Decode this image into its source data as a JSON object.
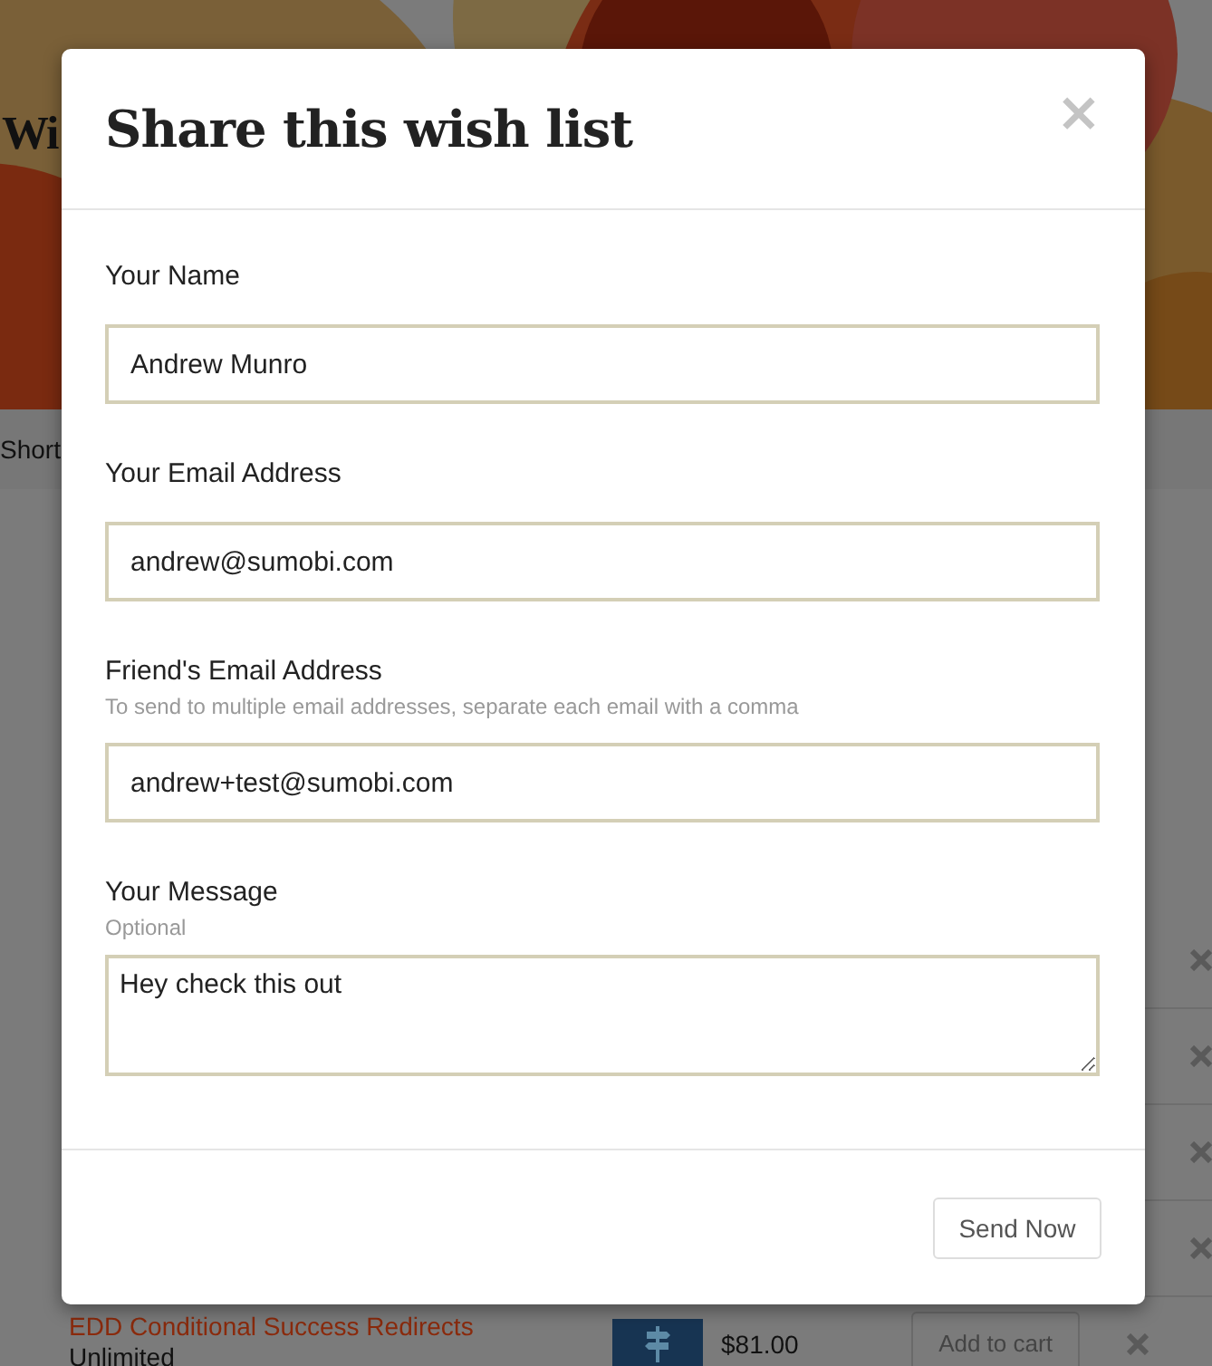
{
  "page": {
    "heading": "Wi",
    "nav_text": "Short",
    "rows": [
      {
        "kind": "covered"
      },
      {
        "kind": "covered"
      },
      {
        "kind": "covered"
      },
      {
        "kind": "covered"
      },
      {
        "kind": "item",
        "title": "EDD Conditional Success Redirects",
        "variant": "Unlimited",
        "price": "$81.00",
        "button": "Add to cart"
      }
    ]
  },
  "dialog": {
    "title": "Share this wish list",
    "close": "×",
    "fields": [
      {
        "kind": "input",
        "label": "Your Name",
        "value": "Andrew Munro"
      },
      {
        "kind": "input",
        "label": "Your Email Address",
        "value": "andrew@sumobi.com"
      },
      {
        "kind": "input",
        "label": "Friend's Email Address",
        "help": "To send to multiple email addresses, separate each email with a comma",
        "value": "andrew+test@sumobi.com"
      },
      {
        "kind": "textarea",
        "label": "Your Message",
        "help": "Optional",
        "value": "Hey check this out"
      }
    ],
    "button": "Send Now"
  }
}
